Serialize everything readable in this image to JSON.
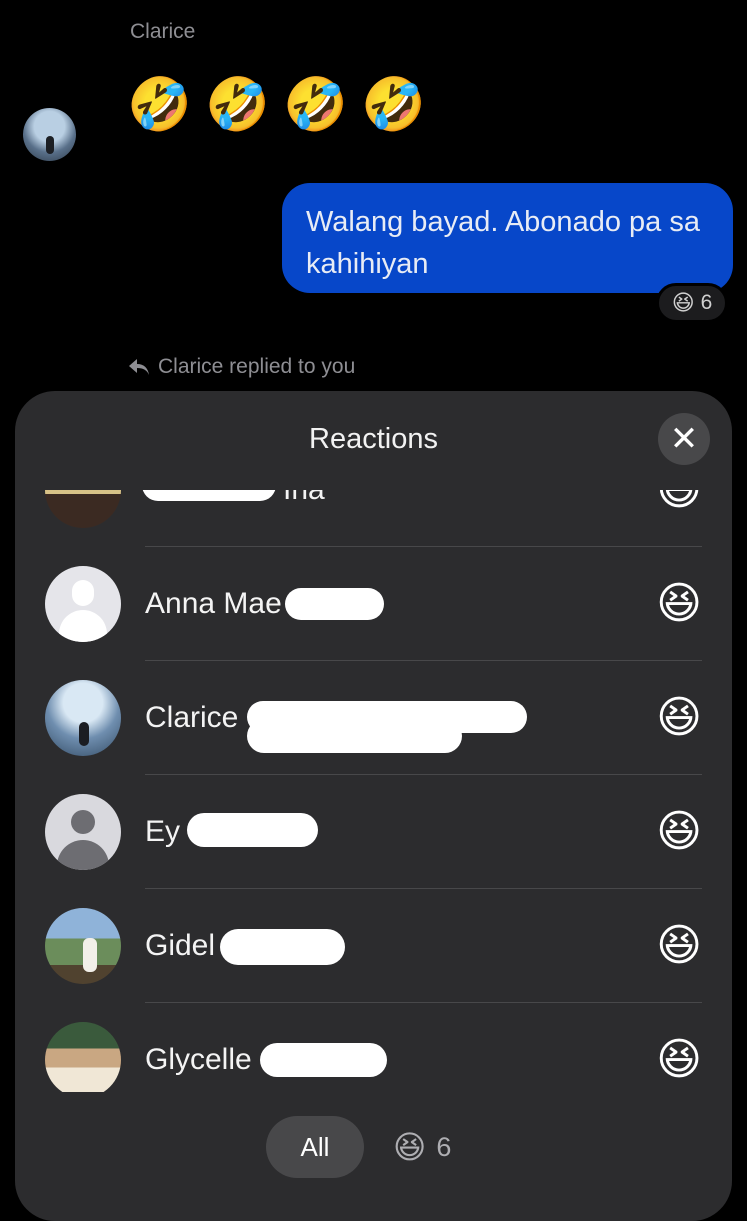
{
  "chat": {
    "sender_name": "Clarice",
    "emoji_message": [
      "🤣",
      "🤣",
      "🤣",
      "🤣"
    ],
    "my_message": "Walang bayad. Abonado pa sa kahihiyan",
    "message_reaction": {
      "emoji": "😆",
      "count": "6"
    },
    "reply_note": "Clarice replied to you",
    "reply_icon": "reply-arrow-icon"
  },
  "sheet": {
    "title": "Reactions",
    "close_icon": "close-icon",
    "reactors": [
      {
        "name": "Ina",
        "reaction": "😆",
        "avatar": "photo"
      },
      {
        "name": "Anna Mae",
        "reaction": "😆",
        "avatar": "placeholder"
      },
      {
        "name": "Clarice",
        "reaction": "😆",
        "avatar": "photo"
      },
      {
        "name": "Ey",
        "reaction": "😆",
        "avatar": "default"
      },
      {
        "name": "Gidel",
        "reaction": "😆",
        "avatar": "photo"
      },
      {
        "name": "Glycelle",
        "reaction": "😆",
        "avatar": "photo"
      }
    ],
    "filters": {
      "all_label": "All",
      "emoji": "😆",
      "count": "6"
    }
  },
  "colors": {
    "background": "#000000",
    "bubble": "#0747c9",
    "sheet": "#2c2c2e",
    "secondary_text": "#8e8e93"
  }
}
